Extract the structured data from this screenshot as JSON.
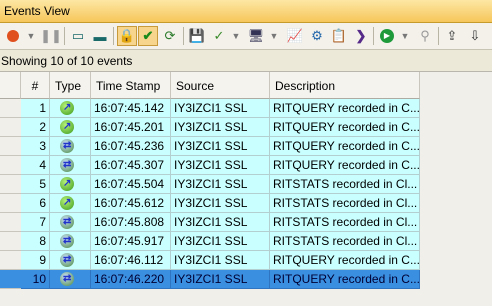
{
  "window": {
    "title": "Events View"
  },
  "status": {
    "text": "Showing 10 of 10 events"
  },
  "columns": [
    "#",
    "Type",
    "Time Stamp",
    "Source",
    "Description"
  ],
  "rows": [
    {
      "num": "1",
      "time": "16:07:45.142",
      "source": "IY3IZCI1 SSL",
      "desc": "RITQUERY recorded in C..."
    },
    {
      "num": "2",
      "time": "16:07:45.201",
      "source": "IY3IZCI1 SSL",
      "desc": "RITQUERY recorded in C..."
    },
    {
      "num": "3",
      "time": "16:07:45.236",
      "source": "IY3IZCI1 SSL",
      "desc": "RITQUERY recorded in C..."
    },
    {
      "num": "4",
      "time": "16:07:45.307",
      "source": "IY3IZCI1 SSL",
      "desc": "RITQUERY recorded in C..."
    },
    {
      "num": "5",
      "time": "16:07:45.504",
      "source": "IY3IZCI1 SSL",
      "desc": "RITSTATS recorded in Cl..."
    },
    {
      "num": "6",
      "time": "16:07:45.612",
      "source": "IY3IZCI1 SSL",
      "desc": "RITSTATS recorded in Cl..."
    },
    {
      "num": "7",
      "time": "16:07:45.808",
      "source": "IY3IZCI1 SSL",
      "desc": "RITSTATS recorded in Cl..."
    },
    {
      "num": "8",
      "time": "16:07:45.917",
      "source": "IY3IZCI1 SSL",
      "desc": "RITSTATS recorded in Cl..."
    },
    {
      "num": "9",
      "time": "16:07:46.112",
      "source": "IY3IZCI1 SSL",
      "desc": "RITQUERY recorded in C..."
    },
    {
      "num": "10",
      "time": "16:07:46.220",
      "source": "IY3IZCI1 SSL",
      "desc": "RITQUERY recorded in C..."
    }
  ],
  "selected_row": "10",
  "colors": {
    "row_bg": "#c9ffff",
    "selected_bg": "#3a8fe0",
    "title_bg": "#f6c65a"
  }
}
